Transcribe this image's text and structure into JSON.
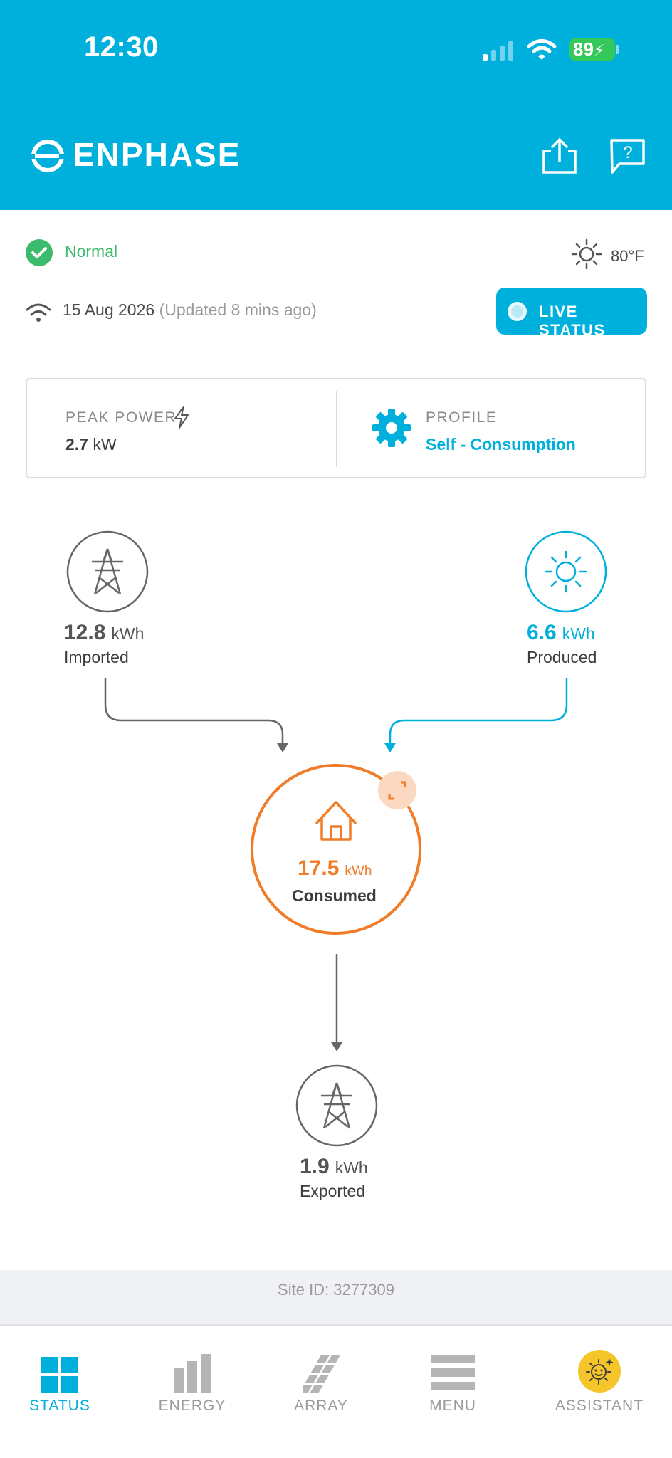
{
  "status_bar": {
    "time": "12:30",
    "battery": "89"
  },
  "header": {
    "brand": "ENPHASE",
    "icons": [
      "share-icon",
      "help-icon"
    ]
  },
  "system": {
    "status": "Normal",
    "temperature": "80°F",
    "date": "15 Aug 2026",
    "updated": "(Updated 8 mins ago)",
    "live_status_label": "LIVE STATUS"
  },
  "card": {
    "peak_power_label": "PEAK POWER",
    "peak_power_value": "2.7",
    "peak_power_unit": "kW",
    "profile_label": "PROFILE",
    "profile_value": "Self - Consumption"
  },
  "flow": {
    "imported": {
      "value": "12.8",
      "unit": "kWh",
      "label": "Imported"
    },
    "produced": {
      "value": "6.6",
      "unit": "kWh",
      "label": "Produced"
    },
    "consumed": {
      "value": "17.5",
      "unit": "kWh",
      "label": "Consumed"
    },
    "exported": {
      "value": "1.9",
      "unit": "kWh",
      "label": "Exported"
    }
  },
  "site": {
    "id_text": "Site ID: 3277309"
  },
  "nav": {
    "items": [
      {
        "label": "STATUS",
        "icon": "status-grid-icon",
        "active": true
      },
      {
        "label": "ENERGY",
        "icon": "bar-chart-icon",
        "active": false
      },
      {
        "label": "ARRAY",
        "icon": "solar-array-icon",
        "active": false
      },
      {
        "label": "MENU",
        "icon": "menu-icon",
        "active": false
      },
      {
        "label": "ASSISTANT",
        "icon": "assistant-sun-icon",
        "active": false
      }
    ]
  },
  "colors": {
    "brand_blue": "#00b0dc",
    "ok_green": "#3dbb6c",
    "consumption_orange": "#f07c28",
    "neutral_gray": "#666666"
  }
}
